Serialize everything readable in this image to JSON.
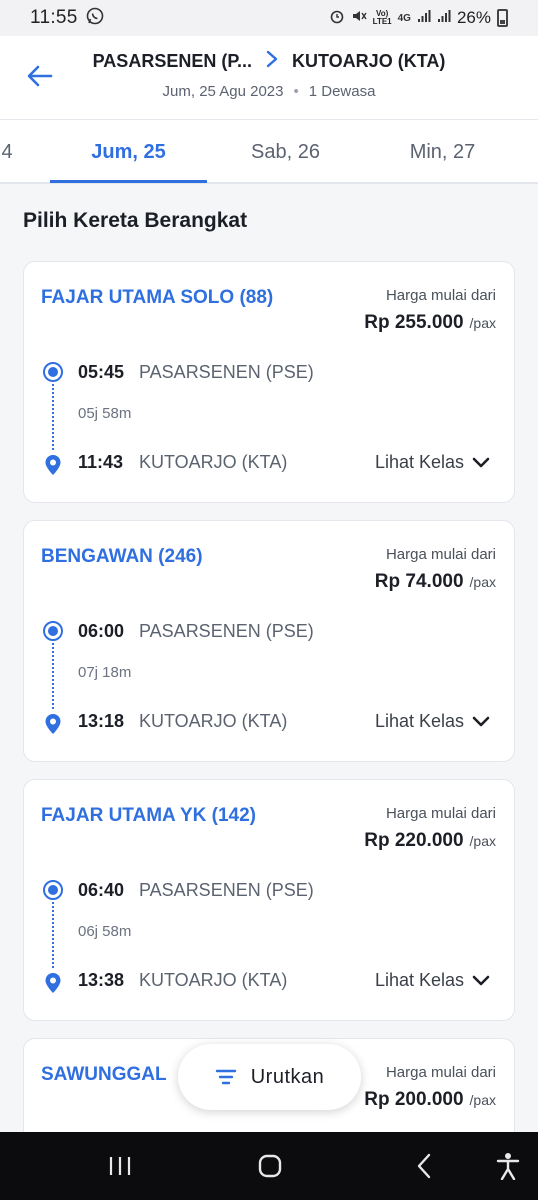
{
  "status_bar": {
    "time": "11:55",
    "lte_top": "Vo)",
    "lte_bottom": "LTE1",
    "network": "4G",
    "battery": "26%"
  },
  "header": {
    "origin": "PASARSENEN (P...",
    "destination": "KUTOARJO (KTA)",
    "date": "Jum, 25 Agu 2023",
    "passengers": "1 Dewasa"
  },
  "date_tabs": [
    {
      "label": "4",
      "active": false
    },
    {
      "label": "Jum, 25",
      "active": true
    },
    {
      "label": "Sab, 26",
      "active": false
    },
    {
      "label": "Min, 27",
      "active": false
    }
  ],
  "section_title": "Pilih Kereta Berangkat",
  "price_label": "Harga mulai dari",
  "pax_label": "/pax",
  "lihat_label": "Lihat Kelas",
  "trains": [
    {
      "name": "FAJAR UTAMA SOLO (88)",
      "price": "Rp 255.000",
      "dep_time": "05:45",
      "dep_station": "PASARSENEN (PSE)",
      "duration": "05j 58m",
      "arr_time": "11:43",
      "arr_station": "KUTOARJO (KTA)"
    },
    {
      "name": "BENGAWAN (246)",
      "price": "Rp 74.000",
      "dep_time": "06:00",
      "dep_station": "PASARSENEN (PSE)",
      "duration": "07j 18m",
      "arr_time": "13:18",
      "arr_station": "KUTOARJO (KTA)"
    },
    {
      "name": "FAJAR UTAMA YK (142)",
      "price": "Rp 220.000",
      "dep_time": "06:40",
      "dep_station": "PASARSENEN (PSE)",
      "duration": "06j 58m",
      "arr_time": "13:38",
      "arr_station": "KUTOARJO (KTA)"
    },
    {
      "name": "SAWUNGGAL",
      "price": "Rp 200.000"
    }
  ],
  "sort_label": "Urutkan",
  "colors": {
    "accent": "#2f6fe0",
    "text": "#1c1f26",
    "muted": "#5c6370"
  }
}
